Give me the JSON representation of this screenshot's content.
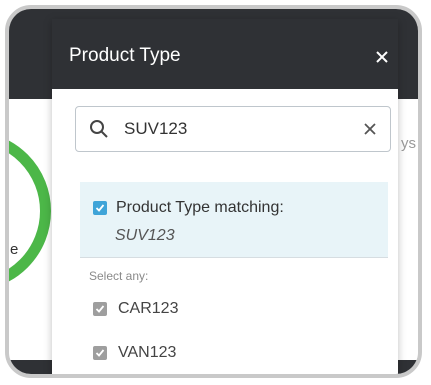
{
  "background": {
    "ring_text": "e",
    "side_text": "ys"
  },
  "panel": {
    "title": "Product Type",
    "close_icon": "close-icon"
  },
  "search": {
    "value": "SUV123",
    "placeholder": "",
    "icon": "search-icon",
    "clear_icon": "clear-icon"
  },
  "match": {
    "label": "Product Type matching:",
    "value": "SUV123",
    "checked": true
  },
  "options": {
    "heading": "Select any:",
    "items": [
      {
        "label": "CAR123",
        "checked": true
      },
      {
        "label": "VAN123",
        "checked": true
      }
    ]
  },
  "colors": {
    "header_bg": "#2f3135",
    "accent_blue": "#3fa4d8",
    "ring_green": "#4cb748",
    "match_bg": "#e8f4f8"
  }
}
